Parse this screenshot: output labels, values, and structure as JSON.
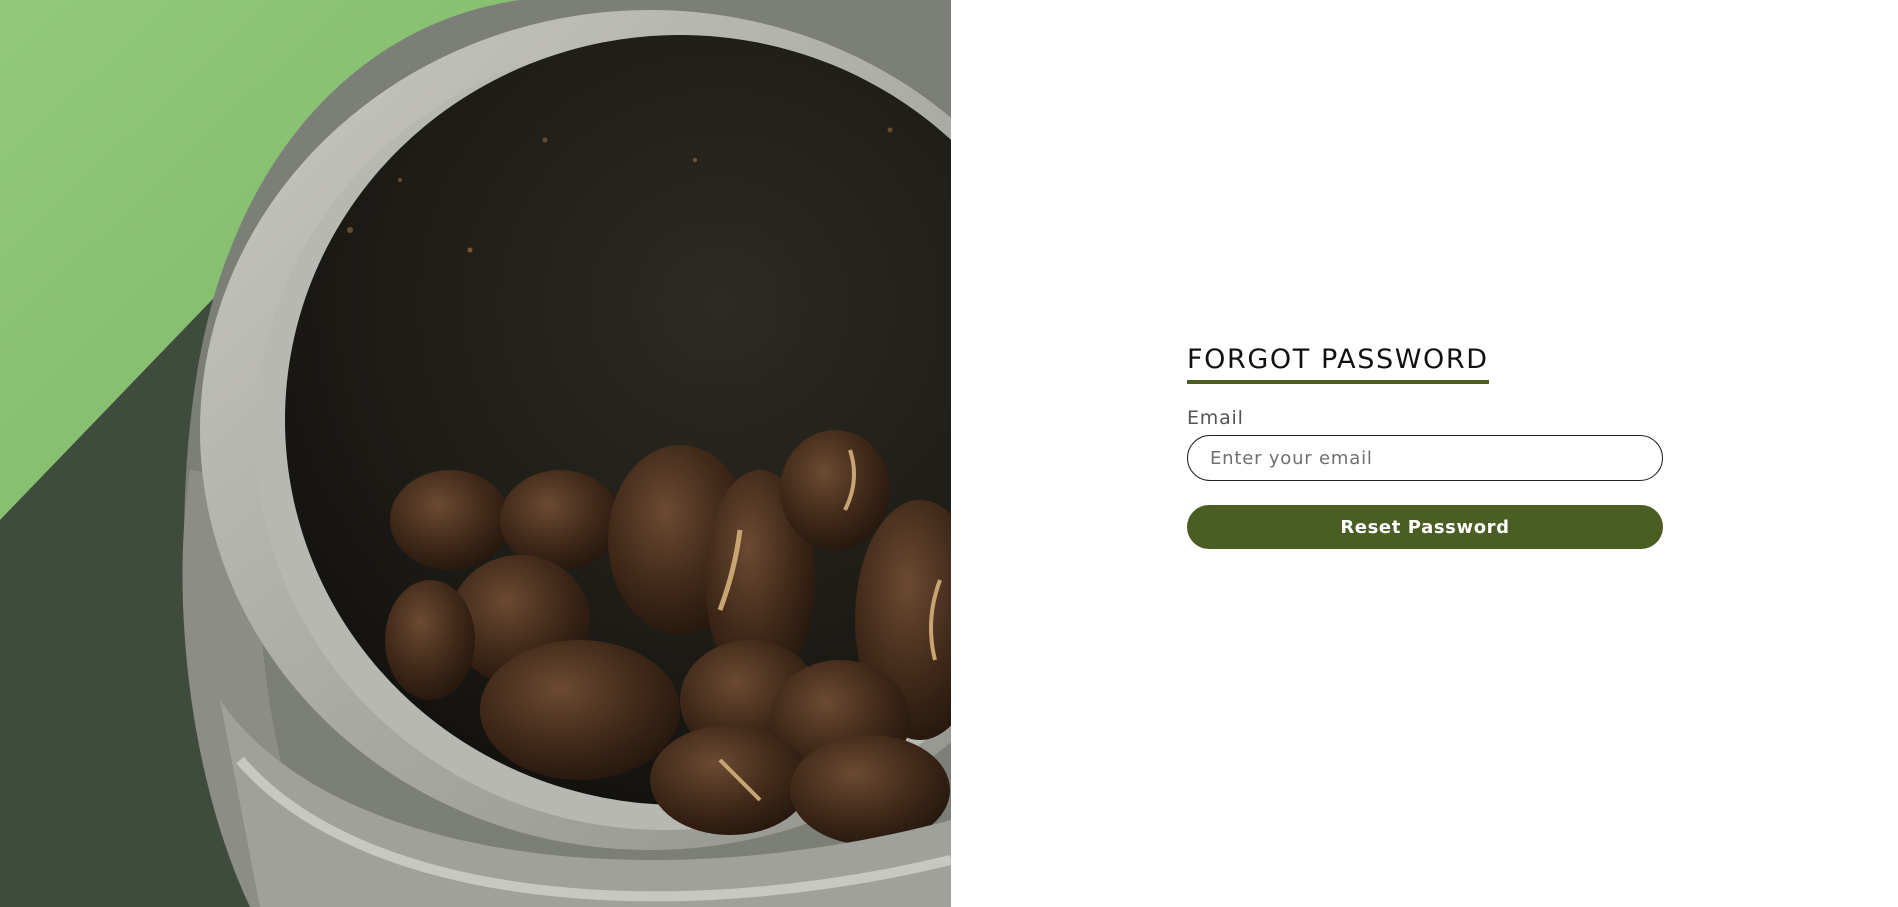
{
  "hero": {
    "image_description_icon": "coffee-beans-grinder-image"
  },
  "form": {
    "title": "FORGOT PASSWORD",
    "email_label": "Email",
    "email_placeholder": "Enter your email",
    "email_value": "",
    "submit_label": "Reset Password"
  },
  "colors": {
    "accent": "#4a5d23",
    "background": "#ffffff",
    "hero_green": "#8cc474",
    "hero_dark": "#3d4a3a"
  }
}
